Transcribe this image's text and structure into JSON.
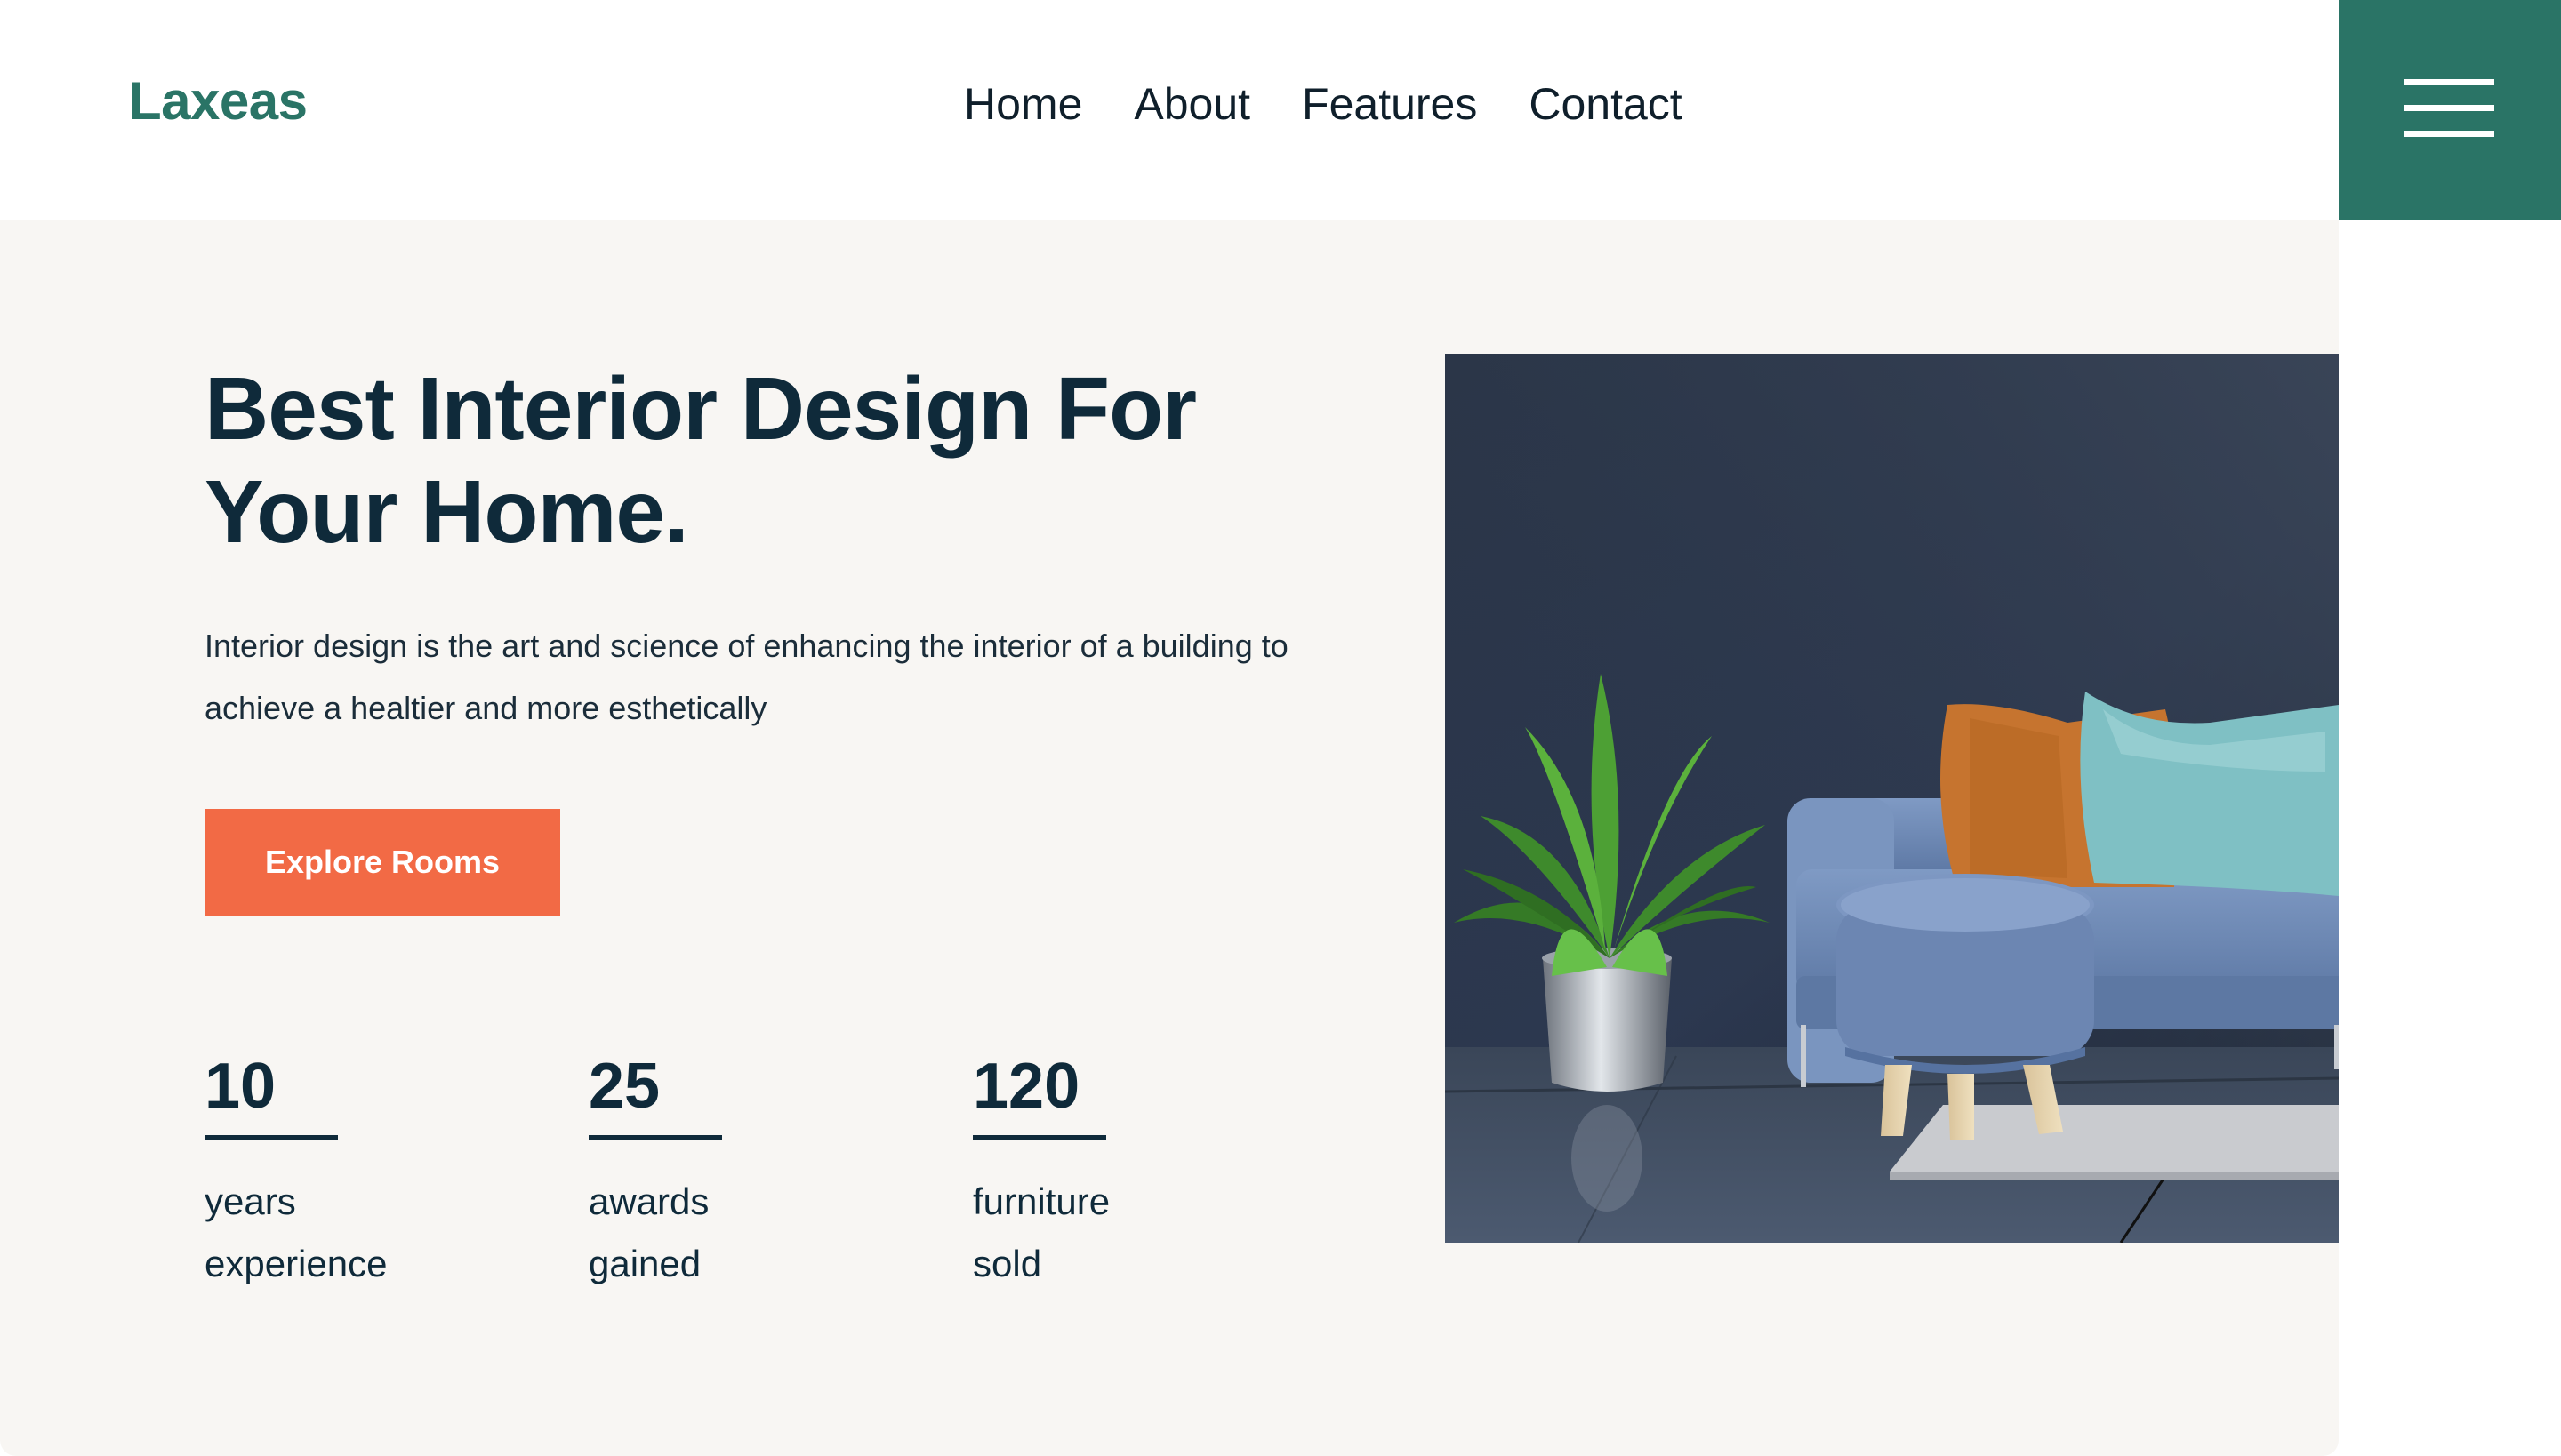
{
  "brand": {
    "name": "Laxeas",
    "accent_color": "#2a7466",
    "cta_color": "#f26a45"
  },
  "nav": {
    "items": [
      {
        "label": "Home"
      },
      {
        "label": "About"
      },
      {
        "label": "Features"
      },
      {
        "label": "Contact"
      }
    ],
    "menu_icon": "hamburger-menu-icon"
  },
  "hero": {
    "title_line1": "Best Interior Design For",
    "title_line2": "Your Home.",
    "description_line1": "Interior design is the art and science of enhancing the interior of a building to",
    "description_line2": "achieve a healtier and more esthetically",
    "cta_label": "Explore Rooms",
    "image_subject": "living room with blue sofa, orange and teal pillows, upholstered stool and potted plant"
  },
  "stats": [
    {
      "value": "10",
      "label_line1": "years",
      "label_line2": "experience"
    },
    {
      "value": "25",
      "label_line1": "awards",
      "label_line2": "gained"
    },
    {
      "value": "120",
      "label_line1": "furniture",
      "label_line2": "sold"
    }
  ]
}
